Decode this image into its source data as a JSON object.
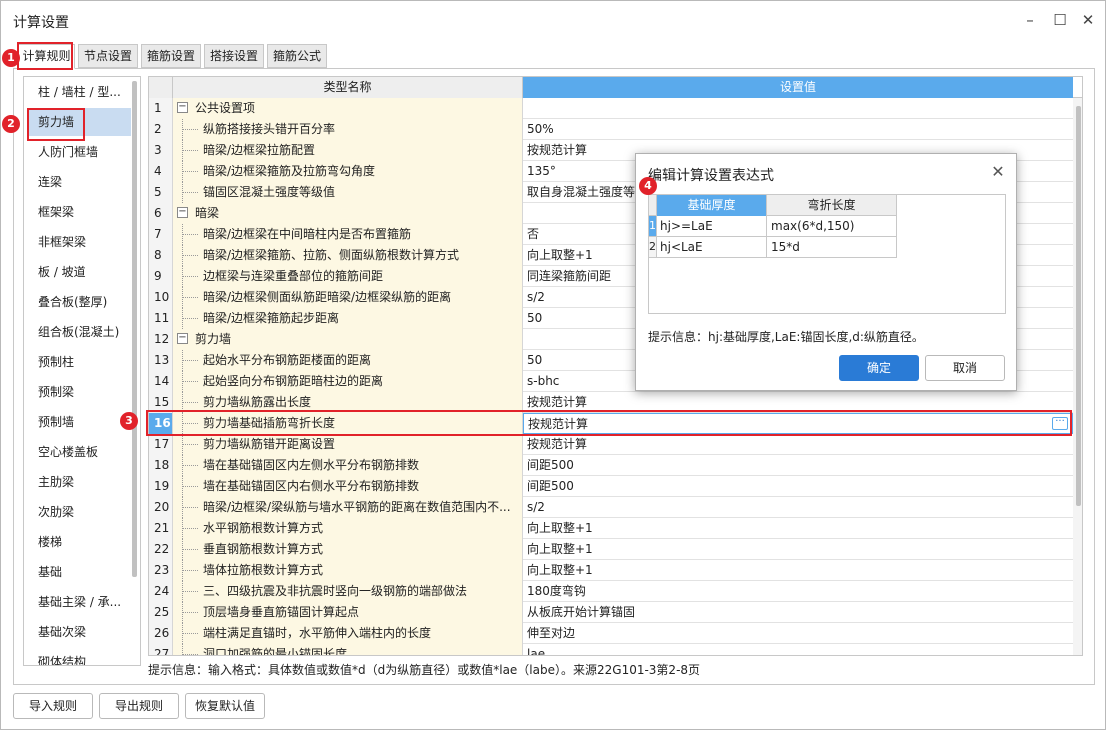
{
  "window": {
    "title": "计算设置",
    "controls": {
      "minimize": "–",
      "maximize": "☐",
      "close": "✕"
    }
  },
  "tabs": [
    "计算规则",
    "节点设置",
    "箍筋设置",
    "搭接设置",
    "箍筋公式"
  ],
  "left_list": [
    "柱 / 墙柱 / 型...",
    "剪力墙",
    "人防门框墙",
    "连梁",
    "框架梁",
    "非框架梁",
    "板 / 坡道",
    "叠合板(整厚)",
    "组合板(混凝土)",
    "预制柱",
    "预制梁",
    "预制墙",
    "空心楼盖板",
    "主肋梁",
    "次肋梁",
    "楼梯",
    "基础",
    "基础主梁 / 承...",
    "基础次梁",
    "砌体结构"
  ],
  "grid": {
    "headers": {
      "name": "类型名称",
      "value": "设置值"
    },
    "rows": [
      {
        "n": "1",
        "name": "公共设置项",
        "value": ""
      },
      {
        "n": "2",
        "name": "纵筋搭接接头错开百分率",
        "value": "50%"
      },
      {
        "n": "3",
        "name": "暗梁/边框梁拉筋配置",
        "value": "按规范计算"
      },
      {
        "n": "4",
        "name": "暗梁/边框梁箍筋及拉筋弯勾角度",
        "value": "135°"
      },
      {
        "n": "5",
        "name": "锚固区混凝土强度等级值",
        "value": "取自身混凝土强度等级"
      },
      {
        "n": "6",
        "name": "暗梁",
        "value": ""
      },
      {
        "n": "7",
        "name": "暗梁/边框梁在中间暗柱内是否布置箍筋",
        "value": "否"
      },
      {
        "n": "8",
        "name": "暗梁/边框梁箍筋、拉筋、侧面纵筋根数计算方式",
        "value": "向上取整+1"
      },
      {
        "n": "9",
        "name": "边框梁与连梁重叠部位的箍筋间距",
        "value": "同连梁箍筋间距"
      },
      {
        "n": "10",
        "name": "暗梁/边框梁侧面纵筋距暗梁/边框梁纵筋的距离",
        "value": "s/2"
      },
      {
        "n": "11",
        "name": "暗梁/边框梁箍筋起步距离",
        "value": "50"
      },
      {
        "n": "12",
        "name": "剪力墙",
        "value": ""
      },
      {
        "n": "13",
        "name": "起始水平分布钢筋距楼面的距离",
        "value": "50"
      },
      {
        "n": "14",
        "name": "起始竖向分布钢筋距暗柱边的距离",
        "value": "s-bhc"
      },
      {
        "n": "15",
        "name": "剪力墙纵筋露出长度",
        "value": "按规范计算"
      },
      {
        "n": "16",
        "name": "剪力墙基础插筋弯折长度",
        "value": "按规范计算"
      },
      {
        "n": "17",
        "name": "剪力墙纵筋错开距离设置",
        "value": "按规范计算"
      },
      {
        "n": "18",
        "name": "墙在基础锚固区内左侧水平分布钢筋排数",
        "value": "间距500"
      },
      {
        "n": "19",
        "name": "墙在基础锚固区内右侧水平分布钢筋排数",
        "value": "间距500"
      },
      {
        "n": "20",
        "name": "暗梁/边框梁/梁纵筋与墙水平钢筋的距离在数值范围内不...",
        "value": "s/2"
      },
      {
        "n": "21",
        "name": "水平钢筋根数计算方式",
        "value": "向上取整+1"
      },
      {
        "n": "22",
        "name": "垂直钢筋根数计算方式",
        "value": "向上取整+1"
      },
      {
        "n": "23",
        "name": "墙体拉筋根数计算方式",
        "value": "向上取整+1"
      },
      {
        "n": "24",
        "name": "三、四级抗震及非抗震时竖向一级钢筋的端部做法",
        "value": "180度弯钩"
      },
      {
        "n": "25",
        "name": "顶层墙身垂直筋锚固计算起点",
        "value": "从板底开始计算锚固"
      },
      {
        "n": "26",
        "name": "端柱满足直锚时，水平筋伸入端柱内的长度",
        "value": "伸至对边"
      },
      {
        "n": "27",
        "name": "洞口加强筋的最小锚固长度",
        "value": "lae"
      }
    ],
    "more_button": "···"
  },
  "hint": "提示信息：输入格式：具体数值或数值*d（d为纵筋直径）或数值*lae（labe）。来源22G101-3第2-8页",
  "buttons": {
    "import": "导入规则",
    "export": "导出规则",
    "reset": "恢复默认值"
  },
  "annotations": [
    "1",
    "2",
    "3",
    "4"
  ],
  "dialog": {
    "title": "编辑计算设置表达式",
    "close": "✕",
    "headers": {
      "c1": "基础厚度",
      "c2": "弯折长度"
    },
    "rows": [
      {
        "n": "1",
        "c1": "hj>=LaE",
        "c2": "max(6*d,150)"
      },
      {
        "n": "2",
        "c1": "hj<LaE",
        "c2": "15*d"
      }
    ],
    "hint": "提示信息：hj:基础厚度,LaE:锚固长度,d:纵筋直径。",
    "ok": "确定",
    "cancel": "取消"
  },
  "colors": {
    "accent": "#5aaaec",
    "annotation": "#e1222a",
    "name_cell_bg": "#fdf8e3",
    "primary_button": "#2a7bd6"
  }
}
